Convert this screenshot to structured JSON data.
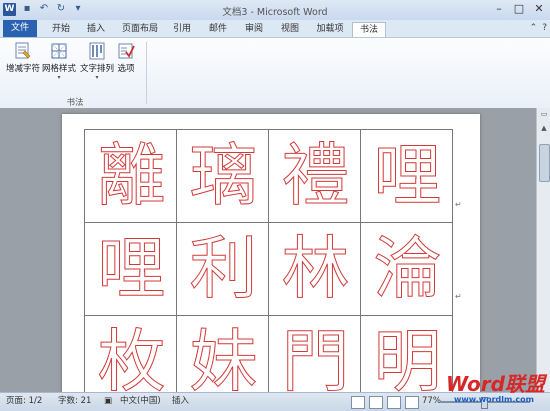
{
  "window": {
    "title": "文档3 - Microsoft Word",
    "app_icon": "W"
  },
  "quick_access": [
    {
      "icon": "save-icon",
      "glyph": "▪"
    },
    {
      "icon": "undo-icon",
      "glyph": "↶"
    },
    {
      "icon": "redo-icon",
      "glyph": "↻"
    },
    {
      "icon": "customize-qat-icon",
      "glyph": "▾"
    }
  ],
  "window_controls": {
    "minimize": "–",
    "maximize": "□",
    "close": "✕"
  },
  "tabs": [
    "文件",
    "开始",
    "插入",
    "页面布局",
    "引用",
    "邮件",
    "审阅",
    "视图",
    "加载项",
    "书法"
  ],
  "ribbon_tools": {
    "minimize_ribbon": "⌃",
    "help": "?"
  },
  "ribbon": {
    "buttons": [
      {
        "label": "增减字符",
        "icon": "add-remove-chars-icon"
      },
      {
        "label": "网格样式",
        "icon": "grid-style-icon",
        "arrow": "▾"
      },
      {
        "label": "文字排列",
        "icon": "text-arrange-icon",
        "arrow": "▾"
      },
      {
        "label": "选项",
        "icon": "options-icon"
      }
    ],
    "group_label": "书法"
  },
  "document": {
    "characters": [
      "離",
      "璃",
      "禮",
      "哩",
      "哩",
      "利",
      "林",
      "淪",
      "枚",
      "妹",
      "門",
      "明"
    ],
    "stroke_color": "#d23a3a"
  },
  "statusbar": {
    "page": "页面: 1/2",
    "words": "字数: 21",
    "language": "中文(中国)",
    "insert": "插入",
    "zoom": "77%"
  },
  "watermark": {
    "brand": "Word联盟",
    "url": "www.wordlm.com"
  },
  "colors": {
    "file_tab": "#2b62b0",
    "accent": "#2b579a"
  }
}
